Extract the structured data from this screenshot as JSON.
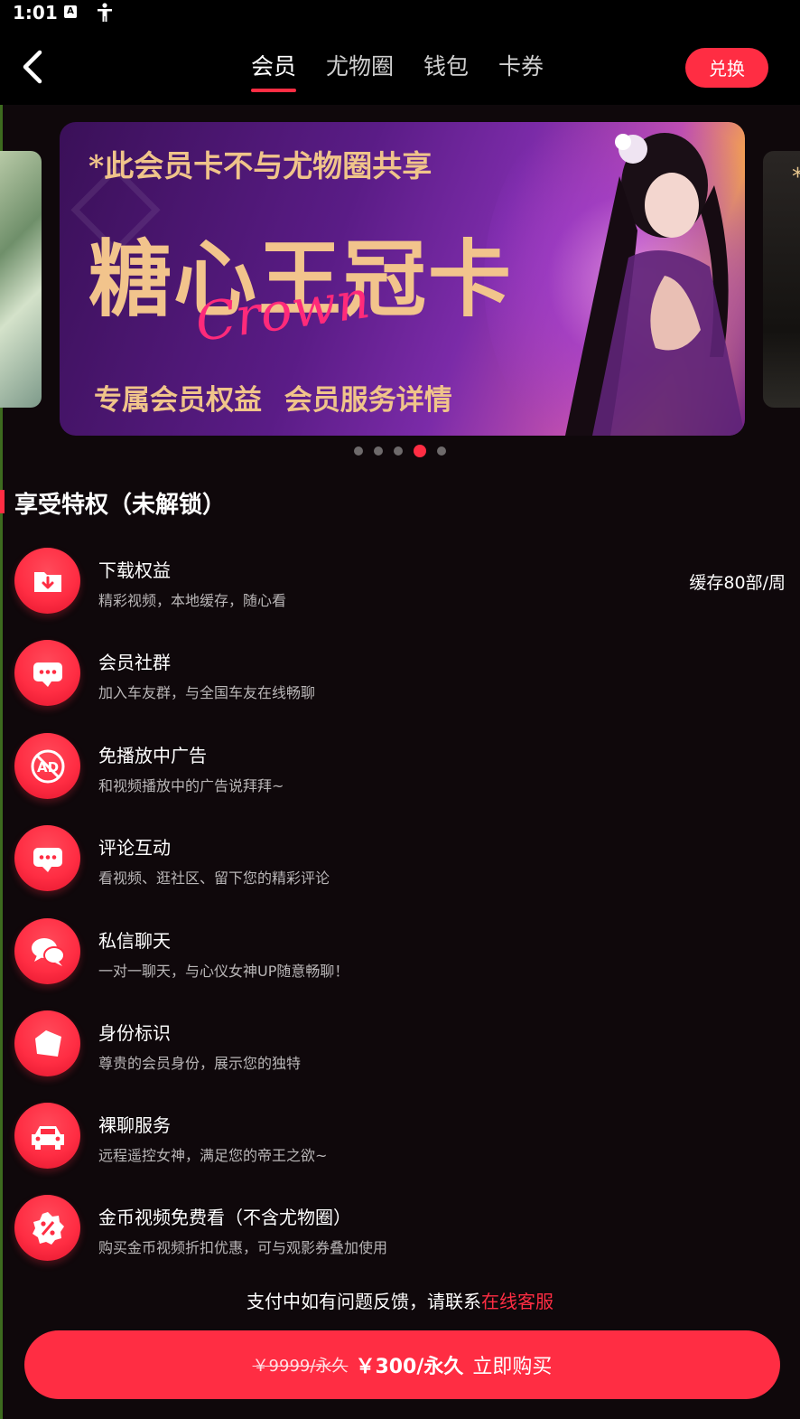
{
  "status": {
    "time": "1:01",
    "icon_a": "A"
  },
  "header": {
    "tabs": [
      {
        "label": "会员",
        "active": true
      },
      {
        "label": "尤物圈",
        "active": false
      },
      {
        "label": "钱包",
        "active": false
      },
      {
        "label": "卡券",
        "active": false
      }
    ],
    "exchange_label": "兑换"
  },
  "banner": {
    "note": "*此会员卡不与尤物圈共享",
    "title": "糖心王冠卡",
    "script": "Crown",
    "footer": "专属会员权益 会员服务详情",
    "side_right_text": "*",
    "dots_total": 5,
    "dots_active_index": 3
  },
  "privileges": {
    "title": "享受特权（未解锁）",
    "items": [
      {
        "title": "下载权益",
        "desc": "精彩视频，本地缓存，随心看",
        "right": "缓存80部/周",
        "icon": "download-folder-icon"
      },
      {
        "title": "会员社群",
        "desc": "加入车友群，与全国车友在线畅聊",
        "icon": "chat-bubble-icon"
      },
      {
        "title": "免播放中广告",
        "desc": "和视频播放中的广告说拜拜~",
        "icon": "no-ad-icon"
      },
      {
        "title": "评论互动",
        "desc": "看视频、逛社区、留下您的精彩评论",
        "icon": "comment-icon"
      },
      {
        "title": "私信聊天",
        "desc": "一对一聊天，与心仪女神UP随意畅聊！",
        "icon": "private-message-icon"
      },
      {
        "title": "身份标识",
        "desc": "尊贵的会员身份，展示您的独特",
        "icon": "badge-tag-icon"
      },
      {
        "title": "裸聊服务",
        "desc": "远程遥控女神，满足您的帝王之欲~",
        "icon": "car-icon"
      },
      {
        "title": "金币视频免费看（不含尤物圈）",
        "desc": "购买金币视频折扣优惠，可与观影券叠加使用",
        "icon": "discount-icon"
      }
    ]
  },
  "contact": {
    "text": "支付中如有问题反馈，请联系",
    "link": "在线客服"
  },
  "buy": {
    "old_price": "￥9999/永久",
    "price": "￥300/永久",
    "action": "立即购买"
  },
  "colors": {
    "accent": "#ff2d43",
    "background": "#0f080b"
  }
}
